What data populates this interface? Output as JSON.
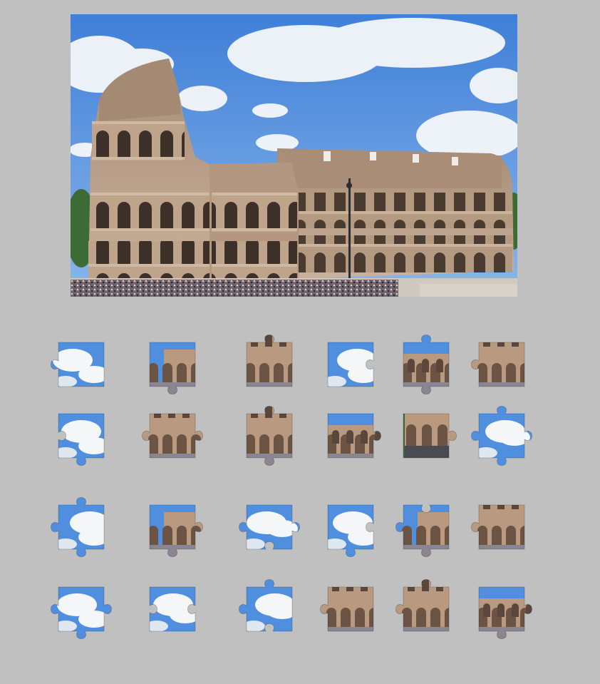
{
  "puzzle": {
    "reference_image": "colosseum-photo",
    "grid": {
      "rows": 4,
      "cols": 6
    },
    "pieces": [
      {
        "id": 1,
        "tabs": {
          "top": "flat",
          "right": "flat",
          "bottom": "flat",
          "left": "out"
        },
        "content": "sky"
      },
      {
        "id": 2,
        "tabs": {
          "top": "flat",
          "right": "flat",
          "bottom": "out",
          "left": "flat"
        },
        "content": "ruin-sky"
      },
      {
        "id": 3,
        "tabs": {
          "top": "out",
          "right": "flat",
          "bottom": "flat",
          "left": "flat"
        },
        "content": "arches"
      },
      {
        "id": 4,
        "tabs": {
          "top": "flat",
          "right": "in",
          "bottom": "flat",
          "left": "flat"
        },
        "content": "sky"
      },
      {
        "id": 5,
        "tabs": {
          "top": "out",
          "right": "flat",
          "bottom": "out",
          "left": "flat"
        },
        "content": "arches-sky"
      },
      {
        "id": 6,
        "tabs": {
          "top": "flat",
          "right": "flat",
          "bottom": "flat",
          "left": "out"
        },
        "content": "arches"
      },
      {
        "id": 7,
        "tabs": {
          "top": "flat",
          "right": "flat",
          "bottom": "out",
          "left": "in"
        },
        "content": "sky"
      },
      {
        "id": 8,
        "tabs": {
          "top": "flat",
          "right": "out",
          "bottom": "flat",
          "left": "out"
        },
        "content": "arches"
      },
      {
        "id": 9,
        "tabs": {
          "top": "out",
          "right": "flat",
          "bottom": "out",
          "left": "flat"
        },
        "content": "arches"
      },
      {
        "id": 10,
        "tabs": {
          "top": "flat",
          "right": "out",
          "bottom": "flat",
          "left": "flat"
        },
        "content": "arches-sky"
      },
      {
        "id": 11,
        "tabs": {
          "top": "flat",
          "right": "out",
          "bottom": "flat",
          "left": "flat"
        },
        "content": "crowd"
      },
      {
        "id": 12,
        "tabs": {
          "top": "out",
          "right": "out",
          "bottom": "out",
          "left": "out"
        },
        "content": "sky"
      },
      {
        "id": 13,
        "tabs": {
          "top": "out",
          "right": "flat",
          "bottom": "out",
          "left": "out"
        },
        "content": "sky"
      },
      {
        "id": 14,
        "tabs": {
          "top": "flat",
          "right": "out",
          "bottom": "out",
          "left": "flat"
        },
        "content": "ruin-sky"
      },
      {
        "id": 15,
        "tabs": {
          "top": "flat",
          "right": "out",
          "bottom": "in",
          "left": "out"
        },
        "content": "sky"
      },
      {
        "id": 16,
        "tabs": {
          "top": "flat",
          "right": "in",
          "bottom": "out",
          "left": "flat"
        },
        "content": "sky"
      },
      {
        "id": 17,
        "tabs": {
          "top": "in",
          "right": "flat",
          "bottom": "out",
          "left": "out"
        },
        "content": "ruin-sky"
      },
      {
        "id": 18,
        "tabs": {
          "top": "flat",
          "right": "flat",
          "bottom": "flat",
          "left": "out"
        },
        "content": "arches"
      },
      {
        "id": 19,
        "tabs": {
          "top": "flat",
          "right": "out",
          "bottom": "out",
          "left": "out"
        },
        "content": "sky"
      },
      {
        "id": 20,
        "tabs": {
          "top": "flat",
          "right": "in",
          "bottom": "flat",
          "left": "in"
        },
        "content": "sky"
      },
      {
        "id": 21,
        "tabs": {
          "top": "out",
          "right": "flat",
          "bottom": "in",
          "left": "out"
        },
        "content": "sky"
      },
      {
        "id": 22,
        "tabs": {
          "top": "flat",
          "right": "flat",
          "bottom": "flat",
          "left": "out"
        },
        "content": "arches"
      },
      {
        "id": 23,
        "tabs": {
          "top": "out",
          "right": "flat",
          "bottom": "flat",
          "left": "out"
        },
        "content": "arches"
      },
      {
        "id": 24,
        "tabs": {
          "top": "flat",
          "right": "out",
          "bottom": "out",
          "left": "flat"
        },
        "content": "arches-sky"
      }
    ]
  },
  "colors": {
    "background": "#c0c0c0",
    "sky": "#4f8fde",
    "cloud": "#f4f6f8",
    "stone": "#b99a80",
    "stone_dark": "#6b5443",
    "crowd": "#4a4a52"
  }
}
